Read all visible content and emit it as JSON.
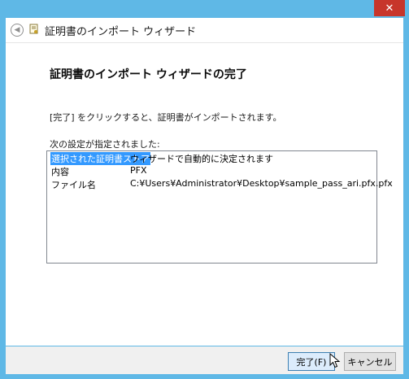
{
  "window": {
    "title": "証明書のインポート ウィザード",
    "close_label": "✕"
  },
  "header": {
    "back_icon": "back-arrow-icon",
    "wizard_icon": "certificate-icon"
  },
  "main": {
    "title": "証明書のインポート ウィザードの完了",
    "instruction": "[完了] をクリックすると、証明書がインポートされます。",
    "settings_label": "次の設定が指定されました:",
    "rows": [
      {
        "key": "選択された証明書ストア",
        "value": "ウィザードで自動的に決定されます"
      },
      {
        "key": "内容",
        "value": "PFX"
      },
      {
        "key": "ファイル名",
        "value": "C:¥Users¥Administrator¥Desktop¥sample_pass_ari.pfx.pfx"
      }
    ]
  },
  "footer": {
    "finish_label": "完了(F)",
    "cancel_label": "キャンセル"
  },
  "colors": {
    "titlebar": "#5fb8e6",
    "close": "#c7352b",
    "selection": "#3399ff"
  }
}
